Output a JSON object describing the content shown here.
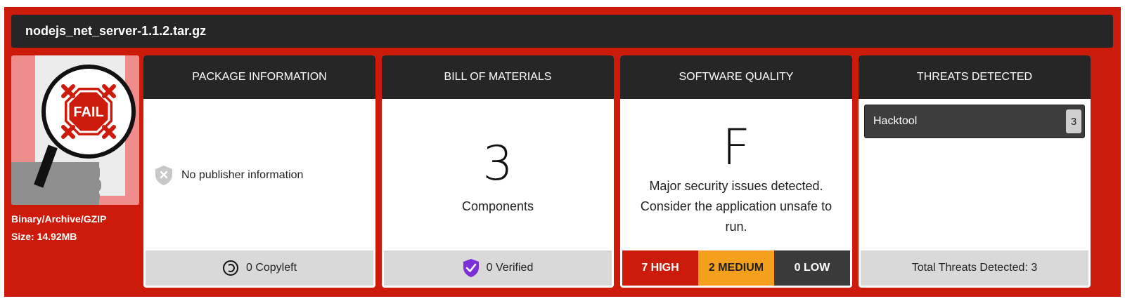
{
  "file": {
    "name": "nodejs_net_server-1.1.2.tar.gz",
    "type": "Binary/Archive/GZIP",
    "size": "Size: 14.92MB",
    "status_badge": "FAIL"
  },
  "package_info": {
    "title": "PACKAGE INFORMATION",
    "publisher": "No publisher information",
    "footer": "0 Copyleft"
  },
  "bill_of_materials": {
    "title": "BILL OF MATERIALS",
    "count": "3",
    "count_label": "Components",
    "footer": "0 Verified"
  },
  "software_quality": {
    "title": "SOFTWARE QUALITY",
    "grade": "F",
    "description": "Major security issues detected. Consider the application unsafe to run.",
    "high": "7 HIGH",
    "medium": "2 MEDIUM",
    "low": "0 LOW"
  },
  "threats": {
    "title": "THREATS DETECTED",
    "items": [
      {
        "label": "Hacktool",
        "count": "3"
      }
    ],
    "footer": "Total Threats Detected: 3"
  },
  "colors": {
    "accent_red": "#cc1b0b",
    "medium_amber": "#f4a01c",
    "dark": "#262626",
    "verified_purple": "#7b2fd6"
  }
}
